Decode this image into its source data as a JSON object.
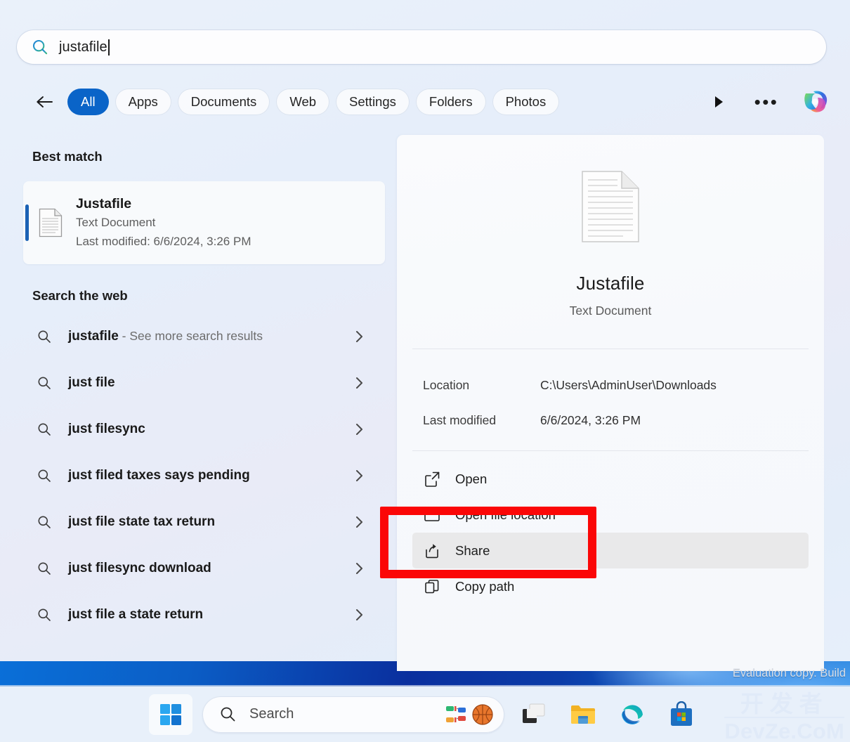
{
  "search": {
    "query": "justafile",
    "icon": "search-icon"
  },
  "filters": {
    "back_icon": "back-arrow-icon",
    "tabs": [
      {
        "label": "All",
        "active": true
      },
      {
        "label": "Apps",
        "active": false
      },
      {
        "label": "Documents",
        "active": false
      },
      {
        "label": "Web",
        "active": false
      },
      {
        "label": "Settings",
        "active": false
      },
      {
        "label": "Folders",
        "active": false
      },
      {
        "label": "Photos",
        "active": false
      }
    ],
    "next_icon": "play-arrow-icon",
    "more_label": "•••",
    "copilot_icon": "copilot-icon"
  },
  "results": {
    "best_match_heading": "Best match",
    "best_match": {
      "name": "Justafile",
      "type": "Text Document",
      "modified": "Last modified: 6/6/2024, 3:26 PM",
      "icon": "text-document-icon"
    },
    "web_heading": "Search the web",
    "web_items": [
      {
        "text": "justafile",
        "suffix": " - See more search results"
      },
      {
        "text": "just file",
        "suffix": ""
      },
      {
        "text": "just filesync",
        "suffix": ""
      },
      {
        "text": "just filed taxes says pending",
        "suffix": ""
      },
      {
        "text": "just file state tax return",
        "suffix": ""
      },
      {
        "text": "just filesync download",
        "suffix": ""
      },
      {
        "text": "just file a state return",
        "suffix": ""
      }
    ]
  },
  "preview": {
    "icon": "text-document-icon",
    "name": "Justafile",
    "type": "Text Document",
    "meta": [
      {
        "key": "Location",
        "value": "C:\\Users\\AdminUser\\Downloads"
      },
      {
        "key": "Last modified",
        "value": "6/6/2024, 3:26 PM"
      }
    ],
    "actions": [
      {
        "label": "Open",
        "icon": "open-external-icon",
        "highlighted": false
      },
      {
        "label": "Open file location",
        "icon": "folder-icon",
        "highlighted": false
      },
      {
        "label": "Share",
        "icon": "share-icon",
        "highlighted": true
      },
      {
        "label": "Copy path",
        "icon": "copy-icon",
        "highlighted": false
      }
    ]
  },
  "annotation": {
    "color": "#fb0707",
    "target": "Share"
  },
  "watermarks": {
    "evaluation": "Evaluation copy. Build",
    "site_cn": "开发者",
    "site_en": "DevZe.CoM"
  },
  "taskbar": {
    "start_icon": "windows-start-icon",
    "search_placeholder": "Search",
    "search_icon": "search-icon",
    "widget_icons": [
      "bracket-widget-icon",
      "basketball-icon"
    ],
    "icons": [
      "task-view-icon",
      "file-explorer-icon",
      "microsoft-edge-icon",
      "microsoft-store-icon"
    ]
  }
}
